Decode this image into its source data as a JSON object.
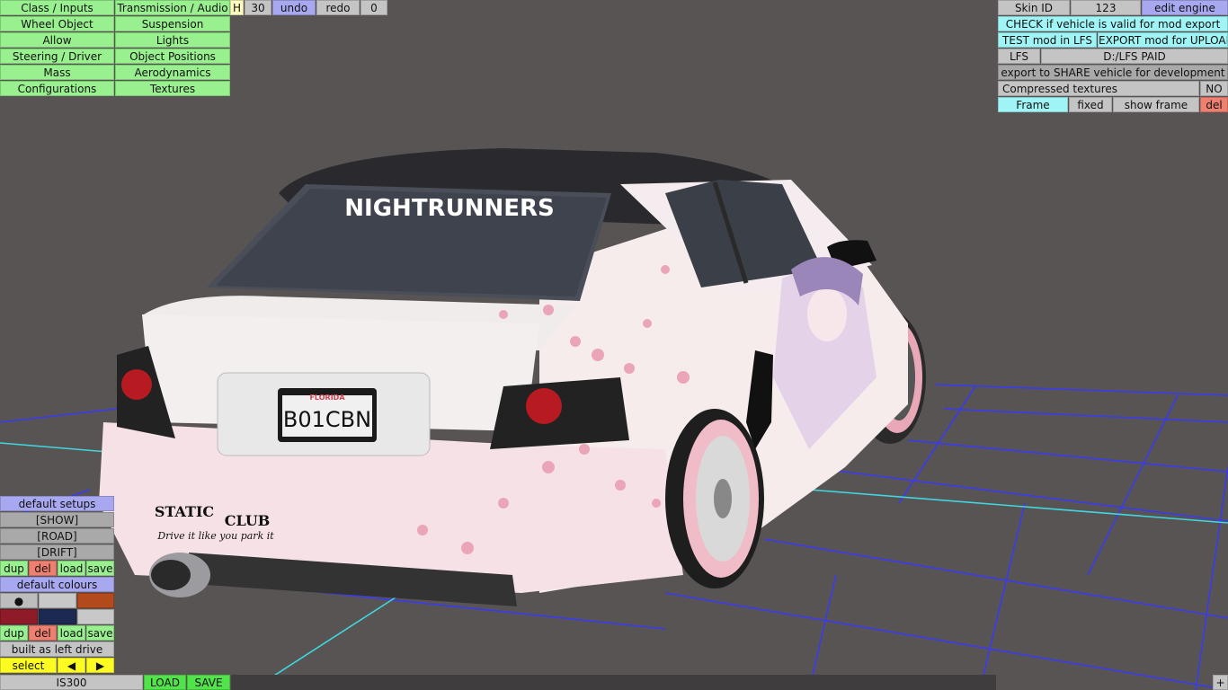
{
  "menu_left": [
    [
      "Class / Inputs",
      "Transmission / Audio"
    ],
    [
      "Wheel Object",
      "Suspension"
    ],
    [
      "Allow",
      "Lights"
    ],
    [
      "Steering / Driver",
      "Object Positions"
    ],
    [
      "Mass",
      "Aerodynamics"
    ],
    [
      "Configurations",
      "Textures"
    ]
  ],
  "toolbar": {
    "h_label": "H",
    "h_value": "30",
    "undo": "undo",
    "redo": "redo",
    "counter": "0"
  },
  "right_panel": {
    "skin_id_label": "Skin ID",
    "skin_id_value": "123",
    "edit_engine": "edit engine",
    "check": "CHECK if vehicle is valid for mod export",
    "test": "TEST mod in LFS",
    "export_upload": "EXPORT mod for UPLOAD",
    "lfs": "LFS",
    "path": "D:/LFS PAID",
    "export_share": "export to SHARE vehicle for development",
    "compressed_label": "Compressed textures",
    "compressed_value": "NO",
    "frame": "Frame",
    "fixed": "fixed",
    "show_frame": "show frame",
    "del": "del"
  },
  "car": {
    "plate_state": "FLORIDA",
    "plate_number": "B01CBN",
    "windshield_banner": "NIGHTRUNNERS",
    "sticker_static": "STATIC",
    "sticker_club": "CLUB",
    "sticker_slogan": "Drive it like you park it"
  },
  "setups": {
    "default_setups": "default setups",
    "items": [
      "[SHOW]",
      "[ROAD]",
      "[DRIFT]"
    ],
    "dup": "dup",
    "del": "del",
    "load": "load",
    "save": "save"
  },
  "colours": {
    "default_colours": "default colours",
    "row1": [
      "#bdbdbd",
      "#c8c8c8",
      "#b24a1c"
    ],
    "row1_marker": "●",
    "row2": [
      "#8e1b27",
      "#1c2a52",
      "#c8c8c8"
    ],
    "dup": "dup",
    "del": "del",
    "load": "load",
    "save": "save"
  },
  "drive": {
    "built_as": "built as left drive",
    "select": "select",
    "prev": "◀",
    "next": "▶"
  },
  "bottom": {
    "model": "IS300",
    "load": "LOAD",
    "save": "SAVE",
    "plus": "+"
  }
}
